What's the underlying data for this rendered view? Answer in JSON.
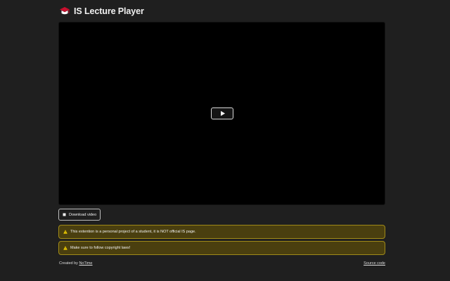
{
  "app": {
    "title": "IS Lecture Player",
    "logo_icon": "graduation-cap-icon"
  },
  "player": {
    "play_icon": "play-icon",
    "play_label": "Play"
  },
  "download": {
    "label": "Download video",
    "icon": "file-icon"
  },
  "alerts": [
    {
      "text": "This extention is a personal project of a student, it is NOT official IS page.",
      "icon": "warning-icon"
    },
    {
      "text": "Make sure to follow copyright laws!",
      "icon": "warning-icon"
    }
  ],
  "footer": {
    "created_by_prefix": "Created by ",
    "author": "NoTime",
    "source_link": "Source code"
  },
  "colors": {
    "background": "#1f1f1f",
    "player_bg": "#000000",
    "alert_bg": "#4a3f0f",
    "alert_border": "#a08a18",
    "brand_red": "#c8102e"
  }
}
